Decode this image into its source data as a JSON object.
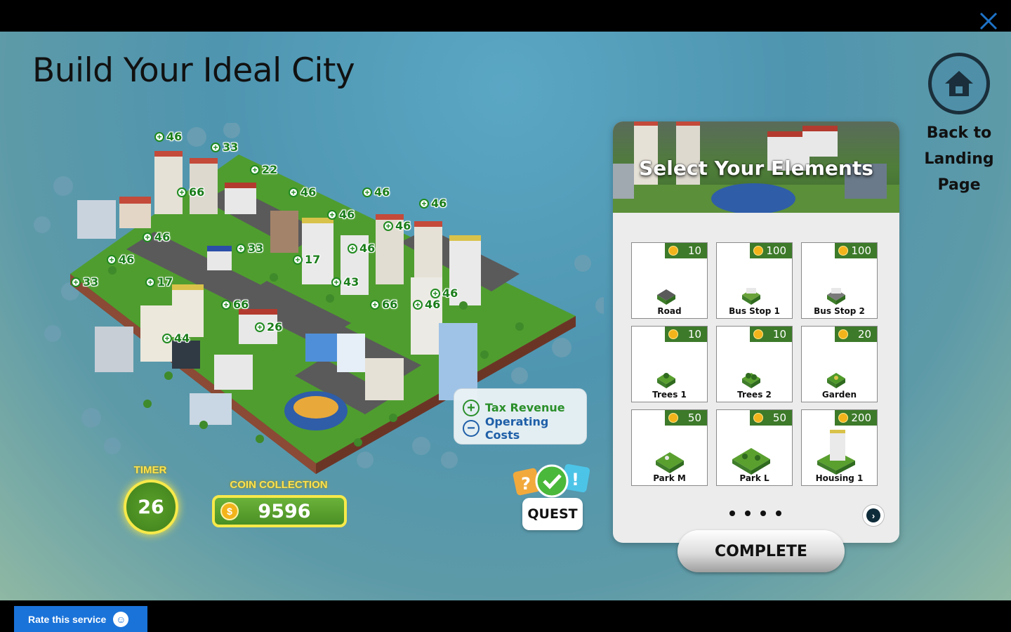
{
  "page": {
    "title": "Build Your Ideal City"
  },
  "home": {
    "label_line1": "Back to",
    "label_line2": "Landing",
    "label_line3": "Page"
  },
  "legend": {
    "tax_revenue": "Tax Revenue",
    "operating_costs": "Operating Costs"
  },
  "quest": {
    "label": "QUEST"
  },
  "timer": {
    "label": "TIMER",
    "value": "26"
  },
  "coins": {
    "label": "COIN COLLECTION",
    "value": "9596"
  },
  "panel": {
    "title": "Select Your Elements",
    "items": [
      {
        "name": "Road",
        "price": "10"
      },
      {
        "name": "Bus Stop 1",
        "price": "100"
      },
      {
        "name": "Bus Stop 2",
        "price": "100"
      },
      {
        "name": "Trees 1",
        "price": "10"
      },
      {
        "name": "Trees 2",
        "price": "10"
      },
      {
        "name": "Garden",
        "price": "20"
      },
      {
        "name": "Park M",
        "price": "50"
      },
      {
        "name": "Park L",
        "price": "50"
      },
      {
        "name": "Housing 1",
        "price": "200"
      }
    ],
    "page_count": 4,
    "complete_label": "COMPLETE"
  },
  "badges": [
    "46",
    "33",
    "22",
    "66",
    "46",
    "46",
    "46",
    "46",
    "46",
    "46",
    "33",
    "46",
    "17",
    "46",
    "33",
    "17",
    "43",
    "46",
    "66",
    "46",
    "66",
    "26",
    "44"
  ],
  "rate": {
    "label": "Rate this service"
  },
  "colors": {
    "accent_green": "#3d7a2a",
    "coin_gold": "#f3b41b",
    "timer_ring": "#f7e94a",
    "rate_blue": "#1a73d9"
  }
}
